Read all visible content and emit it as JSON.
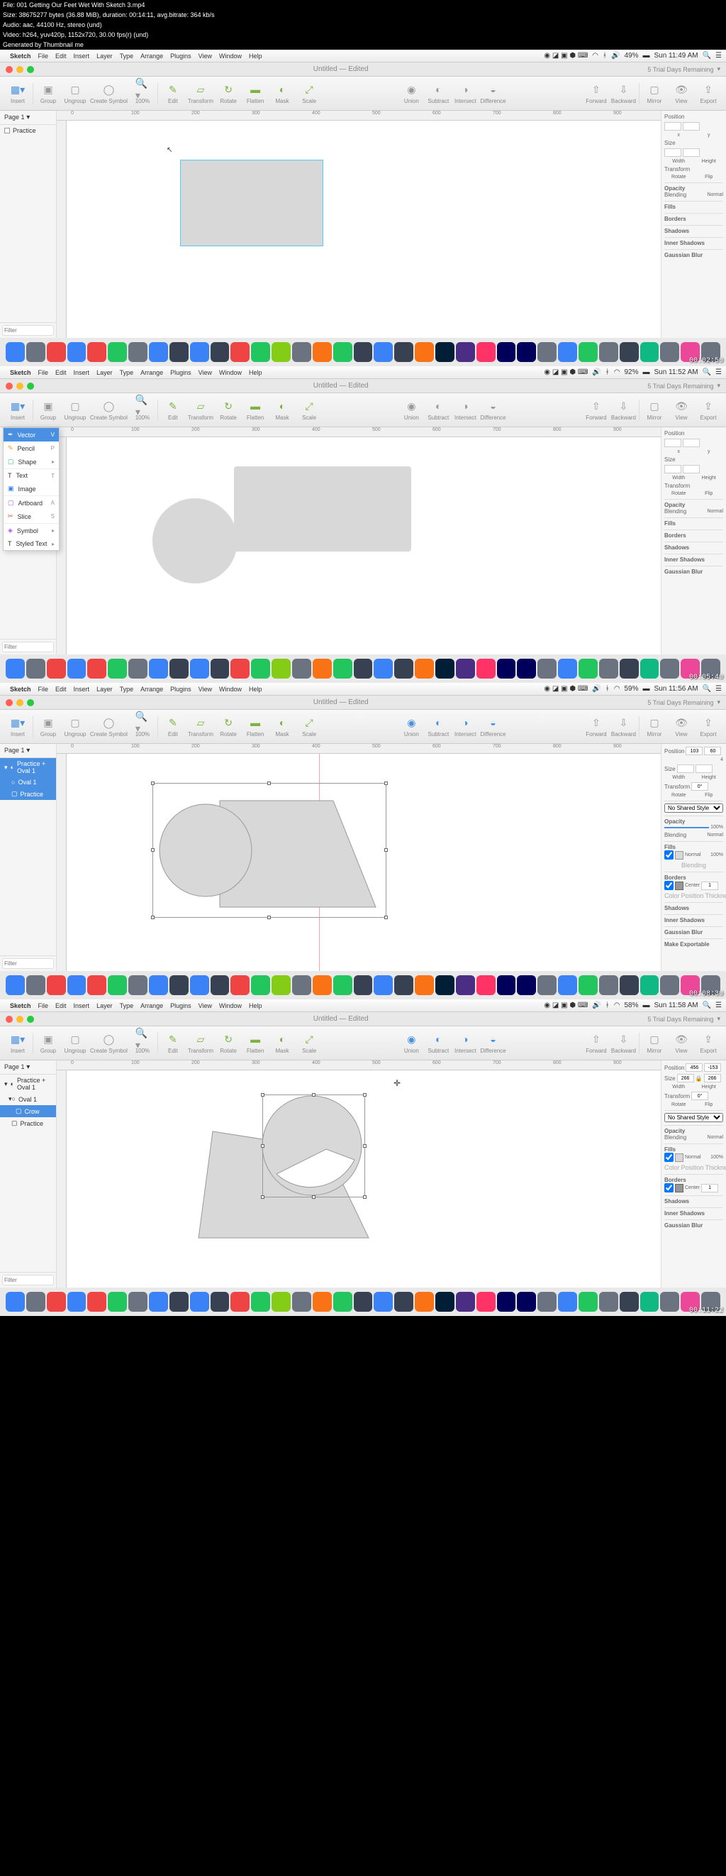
{
  "info": {
    "file": "File: 001 Getting Our Feet Wet With Sketch 3.mp4",
    "size": "Size: 38675277 bytes (36.88 MiB), duration: 00:14:11, avg.bitrate: 364 kb/s",
    "audio": "Audio: aac, 44100 Hz, stereo (und)",
    "video": "Video: h264, yuv420p, 1152x720, 30.00 fps(r) (und)",
    "gen": "Generated by Thumbnail me"
  },
  "menu": {
    "app": "Sketch",
    "items": [
      "File",
      "Edit",
      "Insert",
      "Layer",
      "Type",
      "Arrange",
      "Plugins",
      "View",
      "Window",
      "Help"
    ]
  },
  "status": {
    "battery1": "49%",
    "battery2": "92%",
    "battery3": "59%",
    "battery4": "58%",
    "time1": "Sun 11:49 AM",
    "time2": "Sun 11:52 AM",
    "time3": "Sun 11:56 AM",
    "time4": "Sun 11:58 AM"
  },
  "window": {
    "title": "Untitled — Edited",
    "trial": "5 Trial Days Remaining"
  },
  "toolbar": {
    "insert": "Insert",
    "group": "Group",
    "ungroup": "Ungroup",
    "create": "Create Symbol",
    "zoom": "100%",
    "edit": "Edit",
    "transform": "Transform",
    "rotate": "Rotate",
    "flatten": "Flatten",
    "mask": "Mask",
    "scale": "Scale",
    "union": "Union",
    "subtract": "Subtract",
    "intersect": "Intersect",
    "difference": "Difference",
    "forward": "Forward",
    "backward": "Backward",
    "mirror": "Mirror",
    "view": "View",
    "export": "Export"
  },
  "page": "Page 1",
  "layers": {
    "practice": "Practice",
    "oval": "Oval 1",
    "combo": "Practice + Oval 1",
    "crow": "Crow"
  },
  "filter": "Filter",
  "insert_menu": {
    "vector": "Vector",
    "pencil": "Pencil",
    "shape": "Shape",
    "text": "Text",
    "image": "Image",
    "artboard": "Artboard",
    "slice": "Slice",
    "symbol": "Symbol",
    "styled": "Styled Text",
    "keys": {
      "v": "V",
      "p": "P",
      "t": "T",
      "a": "A",
      "s": "S"
    }
  },
  "insp": {
    "position": "Position",
    "size": "Size",
    "transform": "Transform",
    "opacity": "Opacity",
    "blending": "Blending",
    "normal": "Normal",
    "fills": "Fills",
    "borders": "Borders",
    "shadows": "Shadows",
    "inner": "Inner Shadows",
    "blur": "Gaussian Blur",
    "x": "x",
    "y": "y",
    "width": "Width",
    "height": "Height",
    "rotate": "Rotate",
    "flip": "Flip",
    "shared": "No Shared Style",
    "export": "Make Exportable",
    "center": "Center",
    "color": "Color",
    "pos": "Position",
    "thick": "Thickness",
    "hundred": "100%",
    "one": "1",
    "s3": {
      "x": "103",
      "y": "60",
      "a": "4"
    },
    "s4": {
      "x": "456",
      "y": "-153",
      "w": "266",
      "h": "266"
    }
  },
  "ruler": [
    "0",
    "100",
    "200",
    "300",
    "400",
    "500",
    "600",
    "700",
    "800",
    "900"
  ],
  "ts": {
    "1": "00:02:50",
    "2": "00:05:40",
    "3": "00:08:30",
    "4": "00:11:22"
  }
}
